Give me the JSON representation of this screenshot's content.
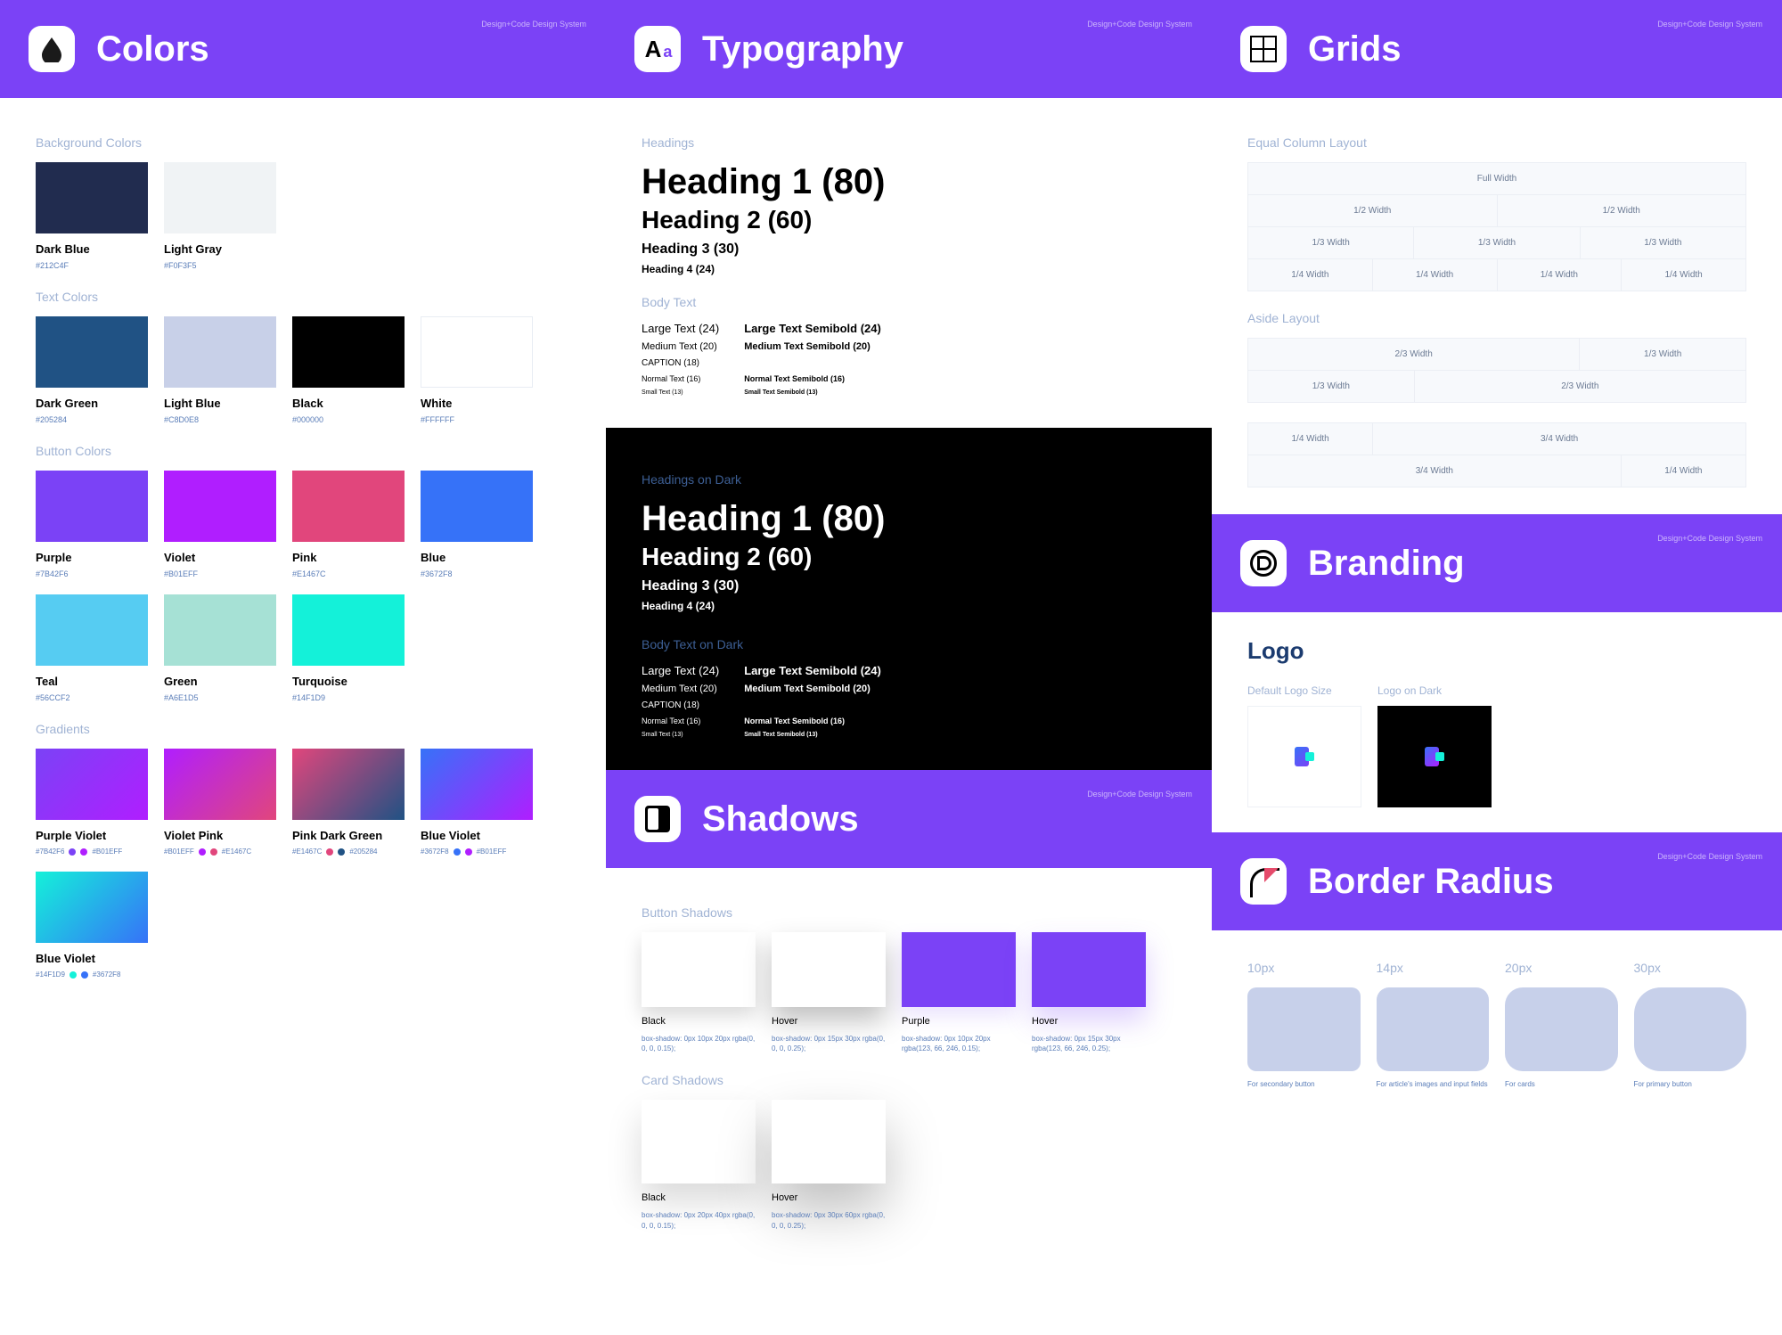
{
  "tag": "Design+Code Design System",
  "colors": {
    "title": "Colors",
    "bgLabel": "Background Colors",
    "textLabel": "Text Colors",
    "btnLabel": "Button Colors",
    "gradLabel": "Gradients",
    "bg": [
      {
        "name": "Dark Blue",
        "hex": "#212C4F"
      },
      {
        "name": "Light Gray",
        "hex": "#F0F3F5"
      }
    ],
    "text": [
      {
        "name": "Dark Green",
        "hex": "#205284"
      },
      {
        "name": "Light Blue",
        "hex": "#C8D0E8"
      },
      {
        "name": "Black",
        "hex": "#000000"
      },
      {
        "name": "White",
        "hex": "#FFFFFF"
      }
    ],
    "btn": [
      {
        "name": "Purple",
        "hex": "#7B42F6"
      },
      {
        "name": "Violet",
        "hex": "#B01EFF"
      },
      {
        "name": "Pink",
        "hex": "#E1467C"
      },
      {
        "name": "Blue",
        "hex": "#3672F8"
      }
    ],
    "btn2": [
      {
        "name": "Teal",
        "hex": "#56CCF2"
      },
      {
        "name": "Green",
        "hex": "#A6E1D5"
      },
      {
        "name": "Turquoise",
        "hex": "#14F1D9"
      }
    ],
    "grad": [
      {
        "name": "Purple Violet",
        "a": "#7B42F6",
        "b": "#B01EFF"
      },
      {
        "name": "Violet Pink",
        "a": "#B01EFF",
        "b": "#E1467C"
      },
      {
        "name": "Pink Dark Green",
        "a": "#E1467C",
        "b": "#205284"
      },
      {
        "name": "Blue Violet",
        "a": "#3672F8",
        "b": "#B01EFF"
      }
    ],
    "grad2": [
      {
        "name": "Blue Violet",
        "a": "#14F1D9",
        "b": "#3672F8"
      }
    ]
  },
  "typo": {
    "title": "Typography",
    "headingsLabel": "Headings",
    "h1": "Heading 1 (80)",
    "h2": "Heading 2 (60)",
    "h3": "Heading 3 (30)",
    "h4": "Heading 4 (24)",
    "bodyLabel": "Body Text",
    "lg": "Large Text (24)",
    "md": "Medium Text (20)",
    "cap": "CAPTION (18)",
    "nm": "Normal Text (16)",
    "sm": "Small Text (13)",
    "lgb": "Large Text Semibold (24)",
    "mdb": "Medium Text Semibold (20)",
    "nmb": "Normal Text Semibold (16)",
    "smb": "Small Text Semibold (13)",
    "headingsDark": "Headings on Dark",
    "bodyDark": "Body Text on Dark"
  },
  "grids": {
    "title": "Grids",
    "eqLabel": "Equal Column Layout",
    "asLabel": "Aside Layout",
    "full": "Full Width",
    "half": "1/2 Width",
    "third": "1/3 Width",
    "quarter": "1/4 Width",
    "twothird": "2/3 Width",
    "threequarter": "3/4 Width"
  },
  "branding": {
    "title": "Branding",
    "logoHead": "Logo",
    "def": "Default Logo Size",
    "dark": "Logo on Dark"
  },
  "shadows": {
    "title": "Shadows",
    "btnLabel": "Button Shadows",
    "cardLabel": "Card Shadows",
    "items": [
      {
        "name": "Black",
        "code": "box-shadow: 0px 10px 20px rgba(0, 0, 0, 0.15);"
      },
      {
        "name": "Hover",
        "code": "box-shadow: 0px 15px 30px rgba(0, 0, 0, 0.25);"
      },
      {
        "name": "Purple",
        "code": "box-shadow: 0px 10px 20px rgba(123, 66, 246, 0.15);"
      },
      {
        "name": "Hover",
        "code": "box-shadow: 0px 15px 30px rgba(123, 66, 246, 0.25);"
      }
    ],
    "cards": [
      {
        "name": "Black",
        "code": "box-shadow: 0px 20px 40px rgba(0, 0, 0, 0.15);"
      },
      {
        "name": "Hover",
        "code": "box-shadow: 0px 30px 60px rgba(0, 0, 0, 0.25);"
      }
    ]
  },
  "radius": {
    "title": "Border Radius",
    "items": [
      {
        "px": "10px",
        "r": 10,
        "cap": "For secondary button"
      },
      {
        "px": "14px",
        "r": 14,
        "cap": "For article's images and input fields"
      },
      {
        "px": "20px",
        "r": 20,
        "cap": "For cards"
      },
      {
        "px": "30px",
        "r": 30,
        "cap": "For primary button"
      }
    ]
  }
}
